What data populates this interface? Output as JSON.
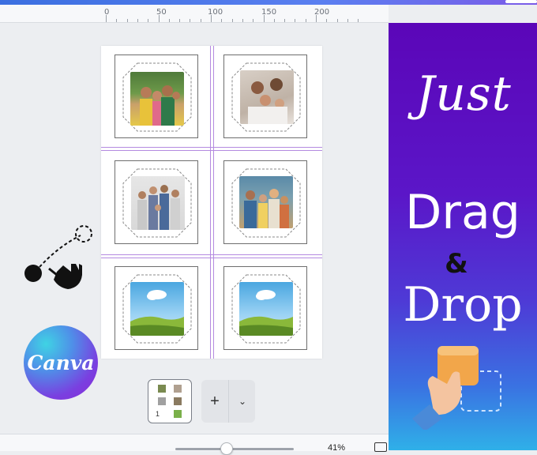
{
  "ruler": {
    "labels": [
      "0",
      "50",
      "100",
      "150",
      "200"
    ]
  },
  "banner": {
    "line1": "Just",
    "line2": "Drag",
    "line3": "&",
    "line4": "Drop"
  },
  "logo": {
    "text": "Canva"
  },
  "pages": {
    "thumb_number": "1"
  },
  "toolbar": {
    "add_label": "+",
    "more_label": "⌄"
  },
  "zoom": {
    "value": "41%",
    "percent": 41
  },
  "colors": {
    "banner_top": "#5b06b8",
    "banner_bottom": "#2fb0e8",
    "guide": "#b48ae0",
    "frame_border": "#6e6e6e"
  },
  "frames": [
    {
      "content": "family-photo-1"
    },
    {
      "content": "family-photo-2"
    },
    {
      "content": "family-photo-3"
    },
    {
      "content": "family-photo-4"
    },
    {
      "content": "placeholder-landscape"
    },
    {
      "content": "placeholder-landscape"
    }
  ]
}
